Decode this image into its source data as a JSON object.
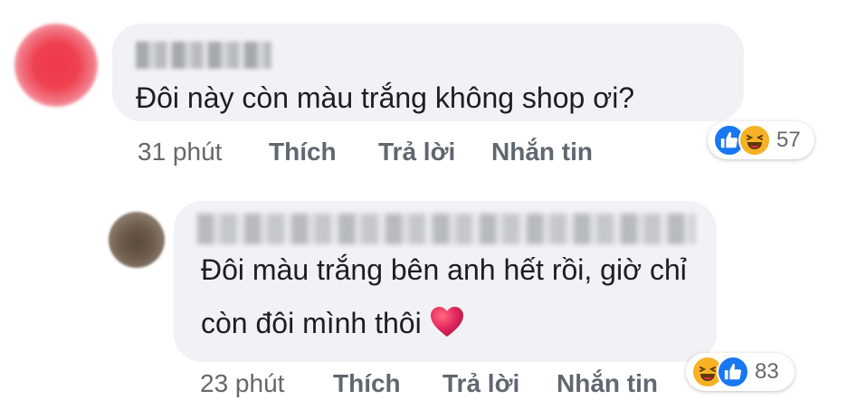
{
  "comments": [
    {
      "text_line1": "Đôi này còn màu trắng không shop ơi?",
      "time": "31 phút",
      "like_label": "Thích",
      "reply_label": "Trả lời",
      "message_label": "Nhắn tin",
      "reactions": {
        "icons": [
          "like-icon",
          "haha-icon"
        ],
        "count": "57"
      }
    },
    {
      "text_line1": "Đôi màu trắng bên anh hết rồi, giờ chỉ",
      "text_line2": "còn đôi mình thôi",
      "emoji": "heart-icon",
      "time": "23 phút",
      "like_label": "Thích",
      "reply_label": "Trả lời",
      "message_label": "Nhắn tin",
      "reactions": {
        "icons": [
          "haha-icon",
          "like-icon"
        ],
        "count": "83"
      }
    }
  ],
  "colors": {
    "bubble": "#f0f2f5",
    "like_blue": "#1877f2",
    "haha_yellow": "#f7b125",
    "heart_red": "#e0245e",
    "meta_text": "#65676b"
  }
}
